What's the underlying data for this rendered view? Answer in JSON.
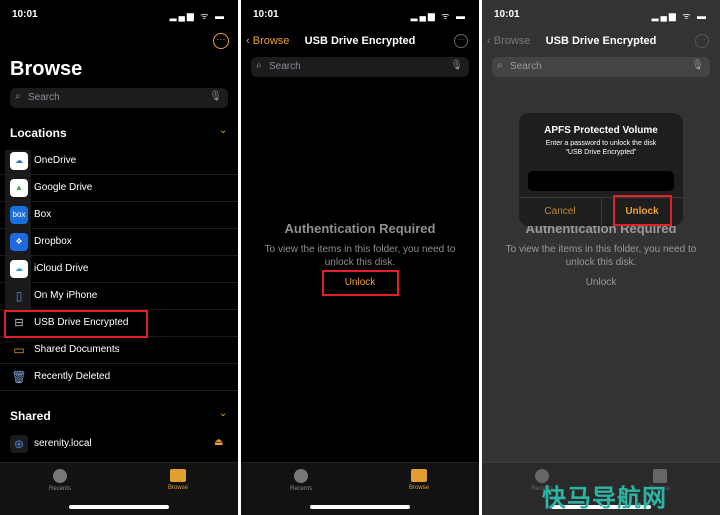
{
  "status": {
    "time": "10:01",
    "icons": "▂▄▆ ᯤ ▬"
  },
  "panel1": {
    "title": "Browse",
    "search_placeholder": "Search",
    "locations_header": "Locations",
    "locations": [
      {
        "label": "OneDrive",
        "icon": "cloud-icon",
        "color": "#2a7ad5"
      },
      {
        "label": "Google Drive",
        "icon": "google-drive-icon",
        "color": "#ffffff"
      },
      {
        "label": "Box",
        "icon": "box-icon",
        "color": "#1a6fdd",
        "text": "box"
      },
      {
        "label": "Dropbox",
        "icon": "dropbox-icon",
        "color": "#1f6ae0"
      },
      {
        "label": "iCloud Drive",
        "icon": "icloud-icon",
        "color": "#ffffff"
      },
      {
        "label": "On My iPhone",
        "icon": "iphone-icon",
        "color": "#1c1c1e"
      },
      {
        "label": "USB Drive Encrypted",
        "icon": "drive-icon",
        "color": "#1c1c1e"
      },
      {
        "label": "Shared Documents",
        "icon": "folder-icon",
        "color": "#1c1c1e"
      },
      {
        "label": "Recently Deleted",
        "icon": "trash-icon",
        "color": "#1c1c1e"
      }
    ],
    "shared_header": "Shared",
    "shared": [
      {
        "label": "serenity.local",
        "icon": "globe-icon"
      }
    ]
  },
  "tabs": [
    {
      "label": "Recents"
    },
    {
      "label": "Browse"
    }
  ],
  "panel2": {
    "back_label": "Browse",
    "nav_title": "USB Drive Encrypted",
    "search_placeholder": "Search",
    "auth_title": "Authentication Required",
    "auth_desc": "To view the items in this folder, you need to unlock this disk.",
    "unlock_label": "Unlock"
  },
  "dialog": {
    "title": "APFS Protected Volume",
    "message_line1": "Enter a password to unlock the disk",
    "message_line2": "“USB Drive Encrypted”",
    "password_value": "",
    "cancel_label": "Cancel",
    "unlock_label": "Unlock"
  },
  "watermark": "快马导航网",
  "colors": {
    "accent": "#f0a030",
    "highlight": "#e0202a"
  }
}
